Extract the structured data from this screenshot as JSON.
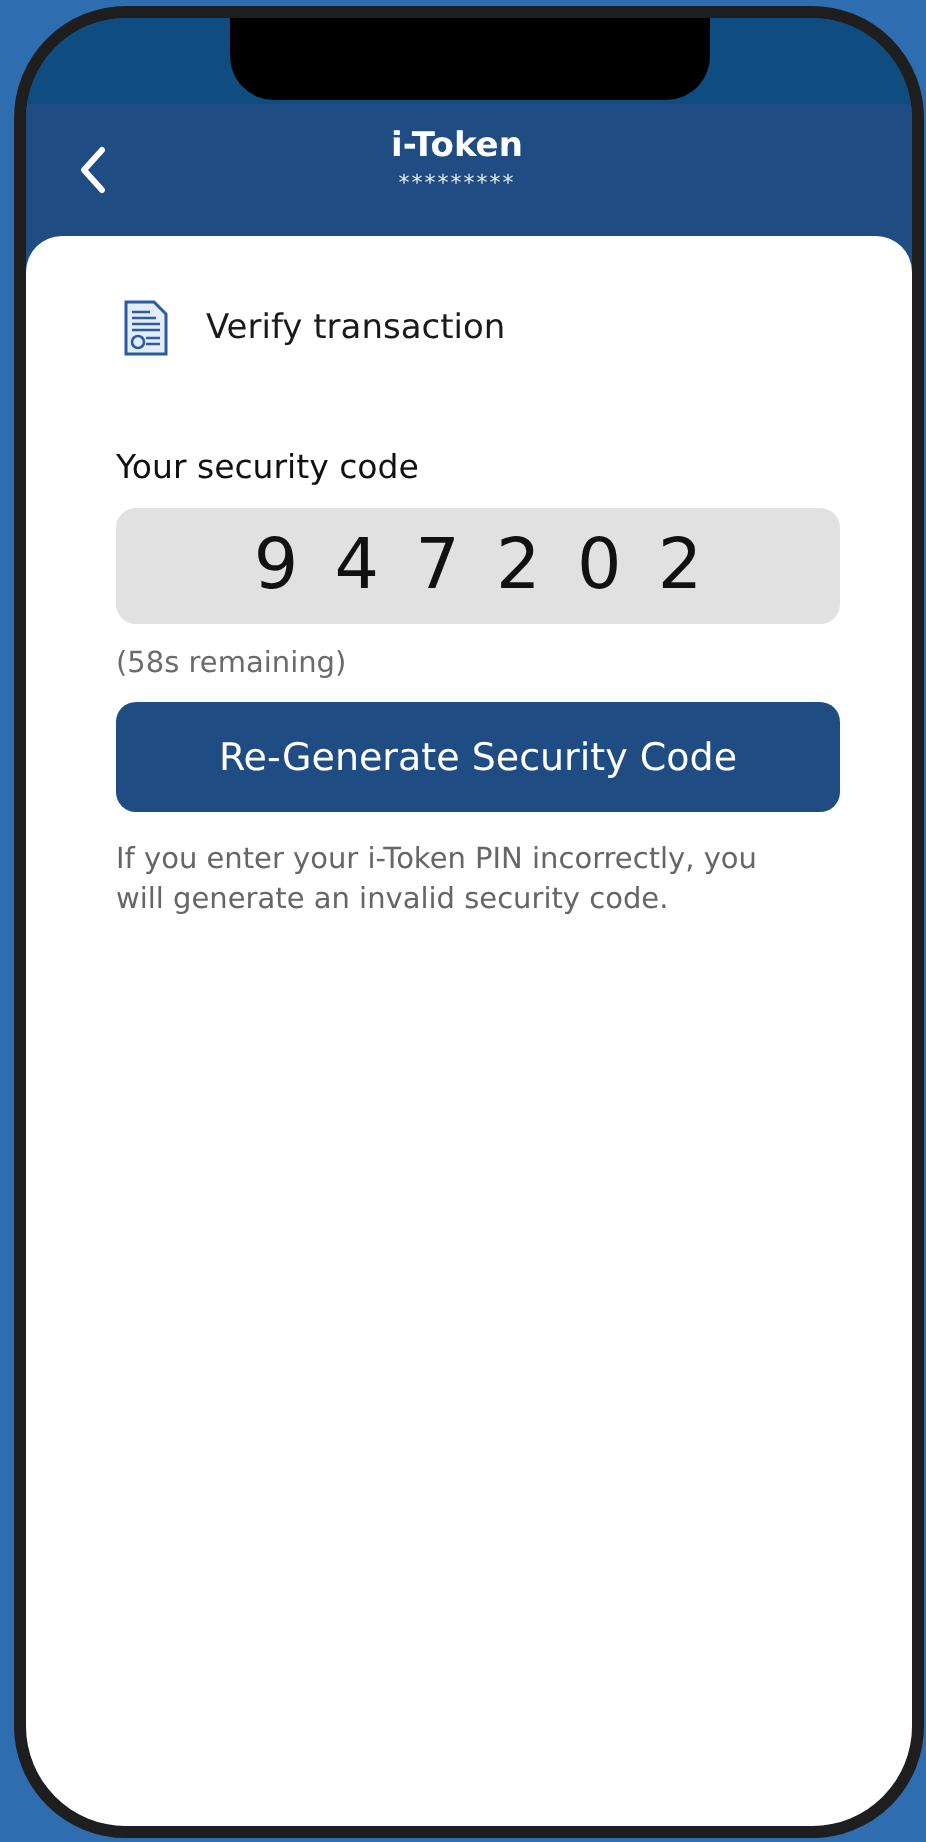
{
  "header": {
    "title": "i-Token",
    "subtitle": "*********"
  },
  "section": {
    "title": "Verify transaction"
  },
  "security_code": {
    "label": "Your security code",
    "code": "9 4 7 2 0 2",
    "remaining": "(58s remaining)"
  },
  "regenerate_button": {
    "label": "Re-Generate Security Code"
  },
  "note": "If you enter your i-Token PIN incorrectly, you will generate an invalid security code."
}
